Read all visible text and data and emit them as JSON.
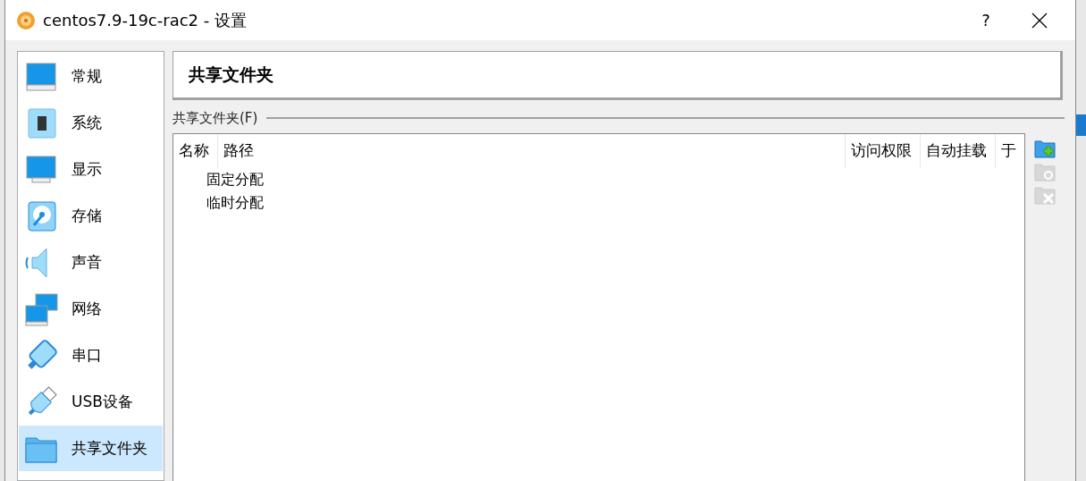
{
  "window": {
    "title": "centos7.9-19c-rac2 - 设置",
    "help": "?"
  },
  "sidebar": {
    "items": [
      {
        "label": "常规",
        "kind": "general",
        "selected": false
      },
      {
        "label": "系统",
        "kind": "system",
        "selected": false
      },
      {
        "label": "显示",
        "kind": "display",
        "selected": false
      },
      {
        "label": "存储",
        "kind": "storage",
        "selected": false
      },
      {
        "label": "声音",
        "kind": "audio",
        "selected": false
      },
      {
        "label": "网络",
        "kind": "network",
        "selected": false
      },
      {
        "label": "串口",
        "kind": "serial",
        "selected": false
      },
      {
        "label": "USB设备",
        "kind": "usb",
        "selected": false
      },
      {
        "label": "共享文件夹",
        "kind": "folder",
        "selected": true
      }
    ]
  },
  "page": {
    "title": "共享文件夹",
    "group_label": "共享文件夹(F)",
    "table": {
      "columns": [
        "名称",
        "路径",
        "访问权限",
        "自动挂载",
        "于"
      ],
      "rows": [
        {
          "label": "固定分配"
        },
        {
          "label": "临时分配"
        }
      ]
    },
    "tools": [
      {
        "kind": "add",
        "disabled": false
      },
      {
        "kind": "edit",
        "disabled": true
      },
      {
        "kind": "remove",
        "disabled": true
      }
    ]
  }
}
